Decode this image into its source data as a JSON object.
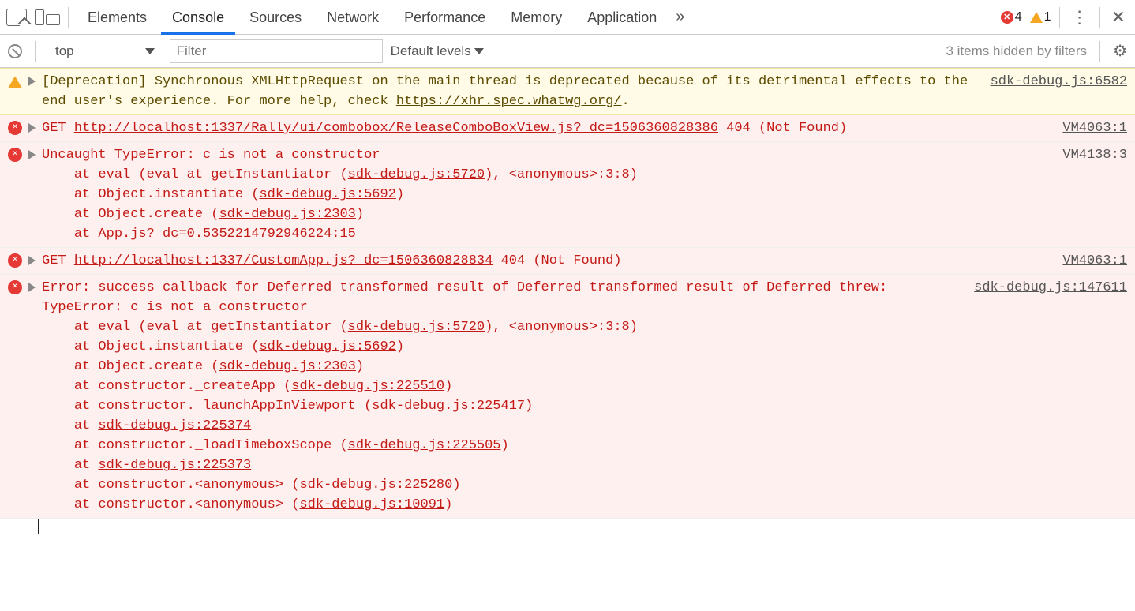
{
  "tabs": {
    "elements": "Elements",
    "console": "Console",
    "sources": "Sources",
    "network": "Network",
    "performance": "Performance",
    "memory": "Memory",
    "application": "Application",
    "more": "»"
  },
  "counts": {
    "errors": "4",
    "warnings": "1"
  },
  "toolbar": {
    "context": "top",
    "filter_placeholder": "Filter",
    "levels": "Default levels",
    "hidden": "3 items hidden by filters"
  },
  "msg1": {
    "text": "[Deprecation] Synchronous XMLHttpRequest on the main thread is deprecated because of its detrimental effects to the end user's experience. For more help, check ",
    "link": "https://xhr.spec.whatwg.org/",
    "tail": ".",
    "src": "sdk-debug.js:6582"
  },
  "msg2": {
    "pre": "GET ",
    "url": "http://localhost:1337/Rally/ui/combobox/ReleaseComboBoxView.js?_dc=1506360828386",
    "status": " 404 (Not Found)",
    "src": "VM4063:1"
  },
  "msg3": {
    "l1": "Uncaught TypeError: c is not a constructor",
    "l2a": "    at eval (eval at getInstantiator (",
    "l2b": "sdk-debug.js:5720",
    "l2c": "), <anonymous>:3:8)",
    "l3a": "    at Object.instantiate (",
    "l3b": "sdk-debug.js:5692",
    "l3c": ")",
    "l4a": "    at Object.create (",
    "l4b": "sdk-debug.js:2303",
    "l4c": ")",
    "l5a": "    at ",
    "l5b": "App.js?_dc=0.5352214792946224:15",
    "src": "VM4138:3"
  },
  "msg4": {
    "pre": "GET ",
    "url": "http://localhost:1337/CustomApp.js?_dc=1506360828834",
    "status": " 404 (Not Found)",
    "src": "VM4063:1"
  },
  "msg5": {
    "l1": "Error: success callback for Deferred transformed result of Deferred transformed result of Deferred threw: TypeError: c is not a constructor",
    "l2a": "    at eval (eval at getInstantiator (",
    "l2b": "sdk-debug.js:5720",
    "l2c": "), <anonymous>:3:8)",
    "l3a": "    at Object.instantiate (",
    "l3b": "sdk-debug.js:5692",
    "l3c": ")",
    "l4a": "    at Object.create (",
    "l4b": "sdk-debug.js:2303",
    "l4c": ")",
    "l5a": "    at constructor._createApp (",
    "l5b": "sdk-debug.js:225510",
    "l5c": ")",
    "l6a": "    at constructor._launchAppInViewport (",
    "l6b": "sdk-debug.js:225417",
    "l6c": ")",
    "l7a": "    at ",
    "l7b": "sdk-debug.js:225374",
    "l8a": "    at constructor._loadTimeboxScope (",
    "l8b": "sdk-debug.js:225505",
    "l8c": ")",
    "l9a": "    at ",
    "l9b": "sdk-debug.js:225373",
    "l10a": "    at constructor.<anonymous> (",
    "l10b": "sdk-debug.js:225280",
    "l10c": ")",
    "l11a": "    at constructor.<anonymous> (",
    "l11b": "sdk-debug.js:10091",
    "l11c": ")",
    "src": "sdk-debug.js:147611"
  }
}
